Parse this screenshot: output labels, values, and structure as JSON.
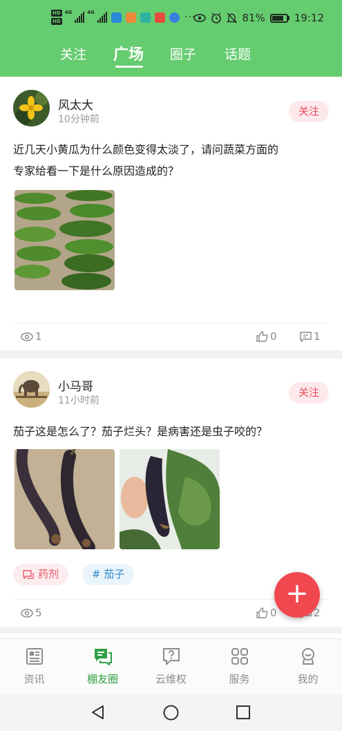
{
  "status_bar": {
    "network_badges": [
      "HD",
      "HD"
    ],
    "net_type_1": "4G",
    "net_type_2": "4G",
    "more": "···",
    "battery": "81%",
    "time": "19:12"
  },
  "top_tabs": [
    {
      "label": "关注",
      "active": false
    },
    {
      "label": "广场",
      "active": true
    },
    {
      "label": "圈子",
      "active": false
    },
    {
      "label": "话题",
      "active": false
    }
  ],
  "posts": [
    {
      "author": "风太大",
      "time": "10分钟前",
      "follow_label": "关注",
      "text_lines": [
        "近几天小黄瓜为什么颜色变得太淡了，请问蔬菜方面的",
        "专家给看一下是什么原因造成的？"
      ],
      "views": "1",
      "likes": "0",
      "comments": "1"
    },
    {
      "author": "小马哥",
      "time": "11小时前",
      "follow_label": "关注",
      "text_lines": [
        "茄子这是怎么了？茄子烂头？是病害还是虫子咬的？"
      ],
      "tags": [
        "药剂",
        "# 茄子"
      ],
      "views": "5",
      "likes": "0",
      "comments": "2"
    }
  ],
  "fab_label": "+",
  "bottom_nav": [
    {
      "label": "资讯",
      "icon": "news-icon",
      "active": false
    },
    {
      "label": "棚友圈",
      "icon": "chat-icon",
      "active": true
    },
    {
      "label": "云维权",
      "icon": "help-icon",
      "active": false
    },
    {
      "label": "服务",
      "icon": "service-icon",
      "active": false
    },
    {
      "label": "我的",
      "icon": "profile-icon",
      "active": false
    }
  ],
  "colors": {
    "header_green": "#66cc70",
    "accent_red": "#e8495c",
    "fab_red": "#f1474f",
    "nav_active": "#2f9e44",
    "tag_blue": "#2c8bd0"
  }
}
